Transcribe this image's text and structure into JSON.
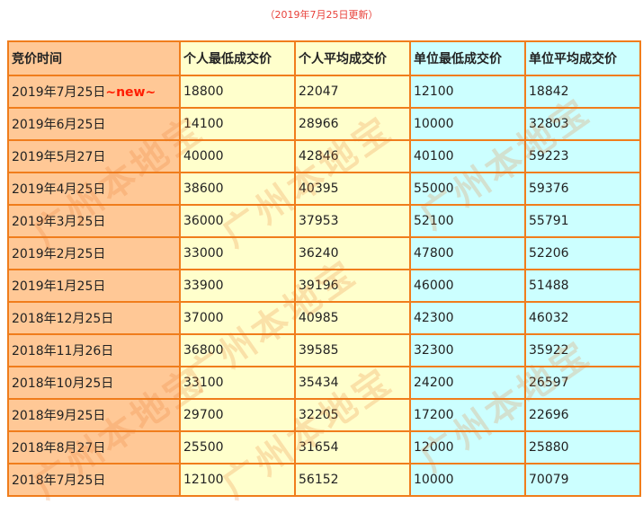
{
  "header": {
    "updated_text": "（2019年7月25日更新）"
  },
  "table": {
    "columns": [
      "竞价时间",
      "个人最低成交价",
      "个人平均成交价",
      "单位最低成交价",
      "单位平均成交价"
    ],
    "rows": [
      {
        "date": "2019年7月25日",
        "tag": "~new~",
        "personal_min": "18800",
        "personal_avg": "22047",
        "unit_min": "12100",
        "unit_avg": "18842",
        "highlight": true
      },
      {
        "date": "2019年6月25日",
        "personal_min": "14100",
        "personal_avg": "28966",
        "unit_min": "10000",
        "unit_avg": "32803"
      },
      {
        "date": "2019年5月27日",
        "personal_min": "40000",
        "personal_avg": "42846",
        "unit_min": "40100",
        "unit_avg": "59223"
      },
      {
        "date": "2019年4月25日",
        "personal_min": "38600",
        "personal_avg": "40395",
        "unit_min": "55000",
        "unit_avg": "59376"
      },
      {
        "date": "2019年3月25日",
        "personal_min": "36000",
        "personal_avg": "37953",
        "unit_min": "52100",
        "unit_avg": "55791"
      },
      {
        "date": "2019年2月25日",
        "personal_min": "33000",
        "personal_avg": "36240",
        "unit_min": "47800",
        "unit_avg": "52206"
      },
      {
        "date": "2019年1月25日",
        "personal_min": "33900",
        "personal_avg": "39196",
        "unit_min": "46000",
        "unit_avg": "51488"
      },
      {
        "date": "2018年12月25日",
        "personal_min": "37000",
        "personal_avg": "40985",
        "unit_min": "42300",
        "unit_avg": "46032"
      },
      {
        "date": "2018年11月26日",
        "personal_min": "36800",
        "personal_avg": "39585",
        "unit_min": "32300",
        "unit_avg": "35922"
      },
      {
        "date": "2018年10月25日",
        "personal_min": "33100",
        "personal_avg": "35434",
        "unit_min": "24200",
        "unit_avg": "26597"
      },
      {
        "date": "2018年9月25日",
        "personal_min": "29700",
        "personal_avg": "32205",
        "unit_min": "17200",
        "unit_avg": "22696"
      },
      {
        "date": "2018年8月27日",
        "personal_min": "25500",
        "personal_avg": "31654",
        "unit_min": "12000",
        "unit_avg": "25880"
      },
      {
        "date": "2018年7月25日",
        "personal_min": "12100",
        "personal_avg": "56152",
        "unit_min": "10000",
        "unit_avg": "70079"
      }
    ]
  },
  "watermark": {
    "text": "广州本地宝",
    "color": "#e87828"
  },
  "colors": {
    "border": "#f07d1c",
    "date_col_bg": "#ffc896",
    "personal_cols_bg": "#ffffcc",
    "unit_cols_bg": "#ccffff",
    "highlight_text": "#e8413a",
    "new_tag": "#ff1c00"
  }
}
